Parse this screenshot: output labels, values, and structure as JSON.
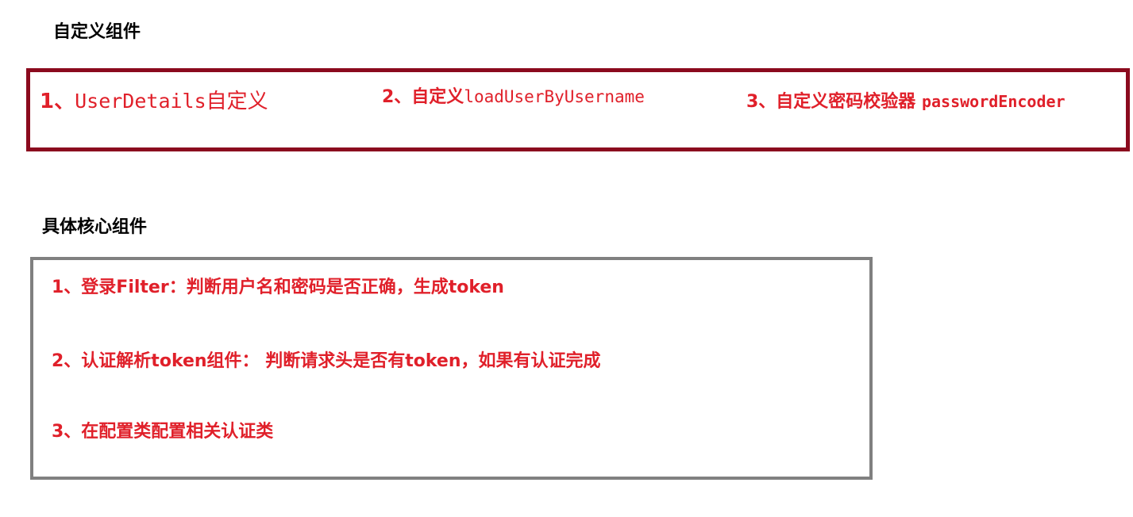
{
  "sections": {
    "custom": {
      "title": "自定义组件",
      "items": [
        {
          "prefix": "1、",
          "code": "UserDetails",
          "suffix": "自定义"
        },
        {
          "prefix": "2、自定义",
          "code": "loadUserByUsername"
        },
        {
          "prefix": "3、自定义密码校验器 ",
          "code": "passwordEncoder"
        }
      ],
      "border_color": "#8b0a1e"
    },
    "core": {
      "title": "具体核心组件",
      "items": [
        "1、登录Filter：判断用户名和密码是否正确，生成token",
        "2、认证解析token组件： 判断请求头是否有token，如果有认证完成",
        "3、在配置类配置相关认证类"
      ],
      "border_color": "#808080"
    }
  },
  "colors": {
    "item_text": "#e0202a",
    "heading_text": "#000000"
  }
}
